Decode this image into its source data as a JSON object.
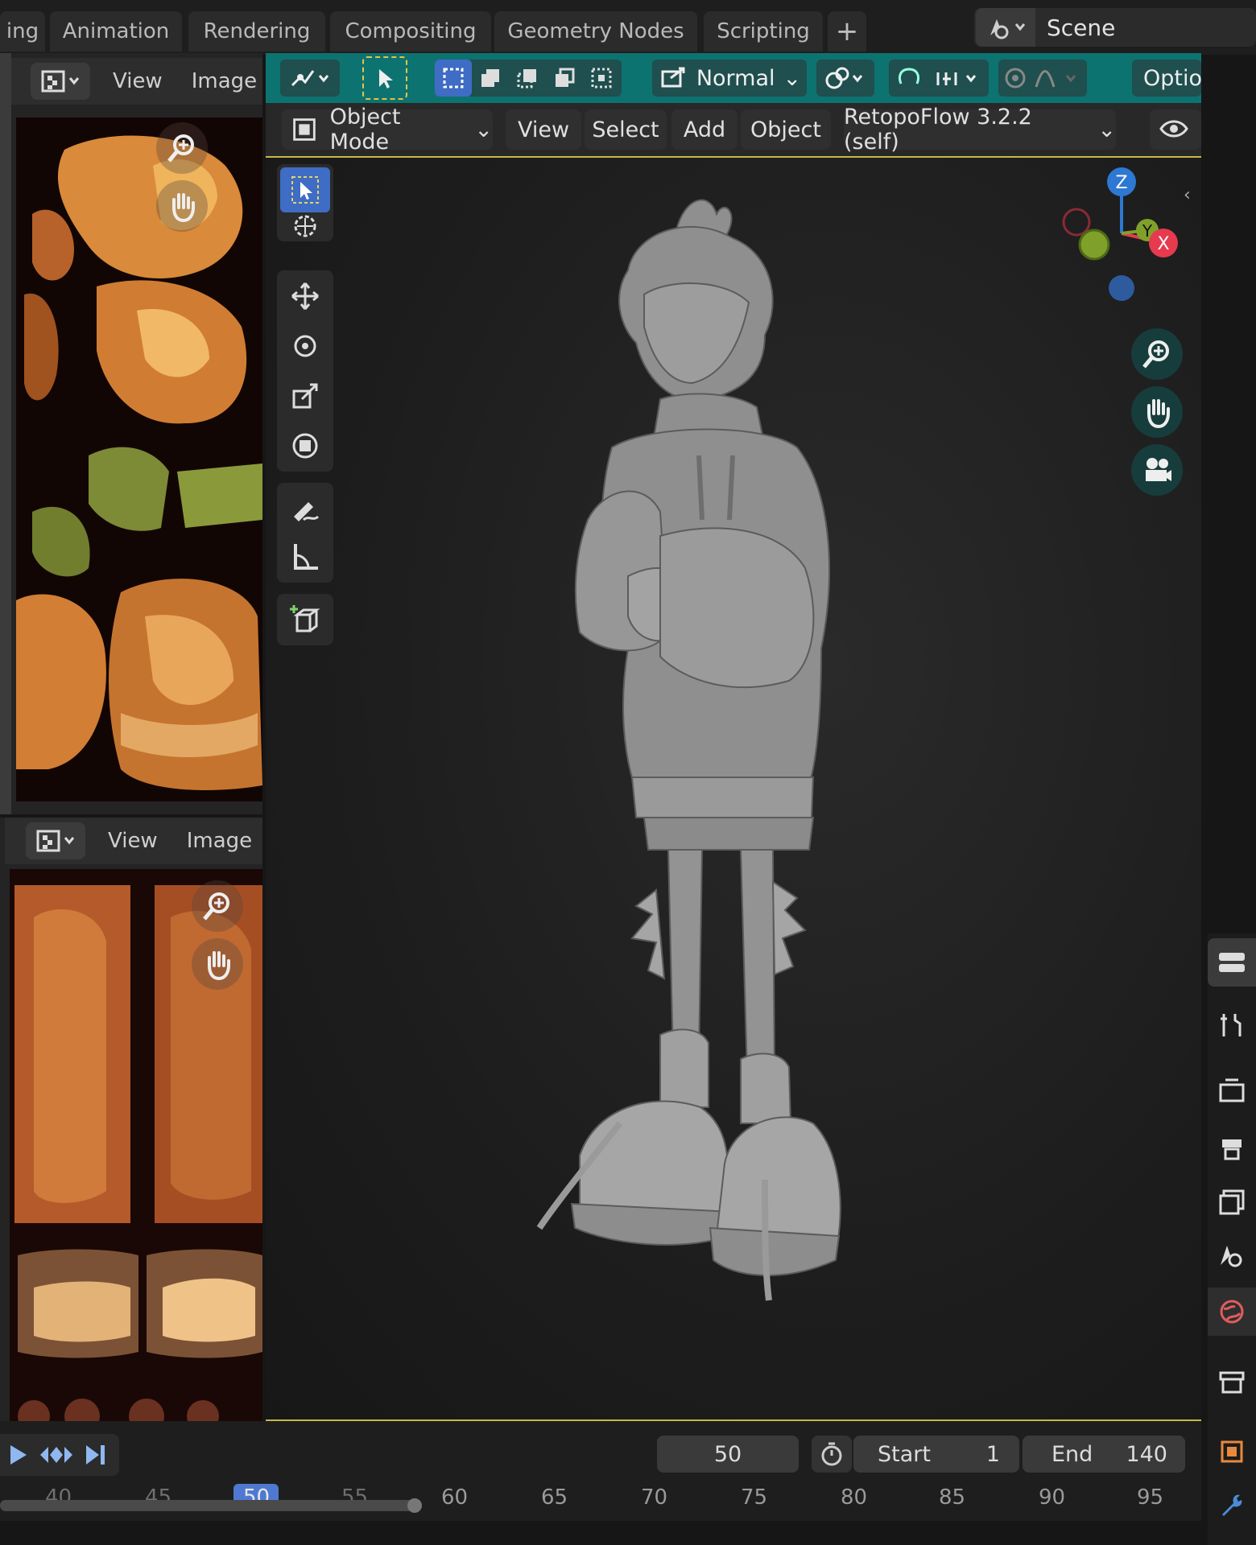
{
  "workspace_tabs": [
    "ing",
    "Animation",
    "Rendering",
    "Compositing",
    "Geometry Nodes",
    "Scripting"
  ],
  "workspace_add": "+",
  "scene": {
    "label": "Scene"
  },
  "image_editor_top": {
    "menus": [
      "View",
      "Image"
    ]
  },
  "image_editor_bottom": {
    "menus": [
      "View",
      "Image"
    ]
  },
  "viewport": {
    "toolbar": {
      "orientation": "Normal",
      "options_label": "Optio"
    },
    "header": {
      "mode": "Object Mode",
      "menus": [
        "View",
        "Select",
        "Add",
        "Object"
      ],
      "addon": "RetopoFlow 3.2.2 (self)"
    },
    "gizmo": {
      "x": "X",
      "y": "Y",
      "z": "Z"
    }
  },
  "timeline": {
    "current_frame": "50",
    "start_label": "Start",
    "start_value": "1",
    "end_label": "End",
    "end_value": "140",
    "ticks": [
      "40",
      "45",
      "50",
      "55",
      "60",
      "65",
      "70",
      "75",
      "80",
      "85",
      "90",
      "95"
    ]
  },
  "colors": {
    "header_teal": "#0d7370",
    "axis_x": "#e63a4f",
    "axis_y": "#7fa12a",
    "axis_z": "#2d78d2",
    "active_tool": "#3f6cc4",
    "frame_indicator": "#4f79d1"
  },
  "icons": [
    "search-icon",
    "hand-icon",
    "camera-icon",
    "play-icon",
    "keyframe-icon",
    "jump-end-icon"
  ]
}
